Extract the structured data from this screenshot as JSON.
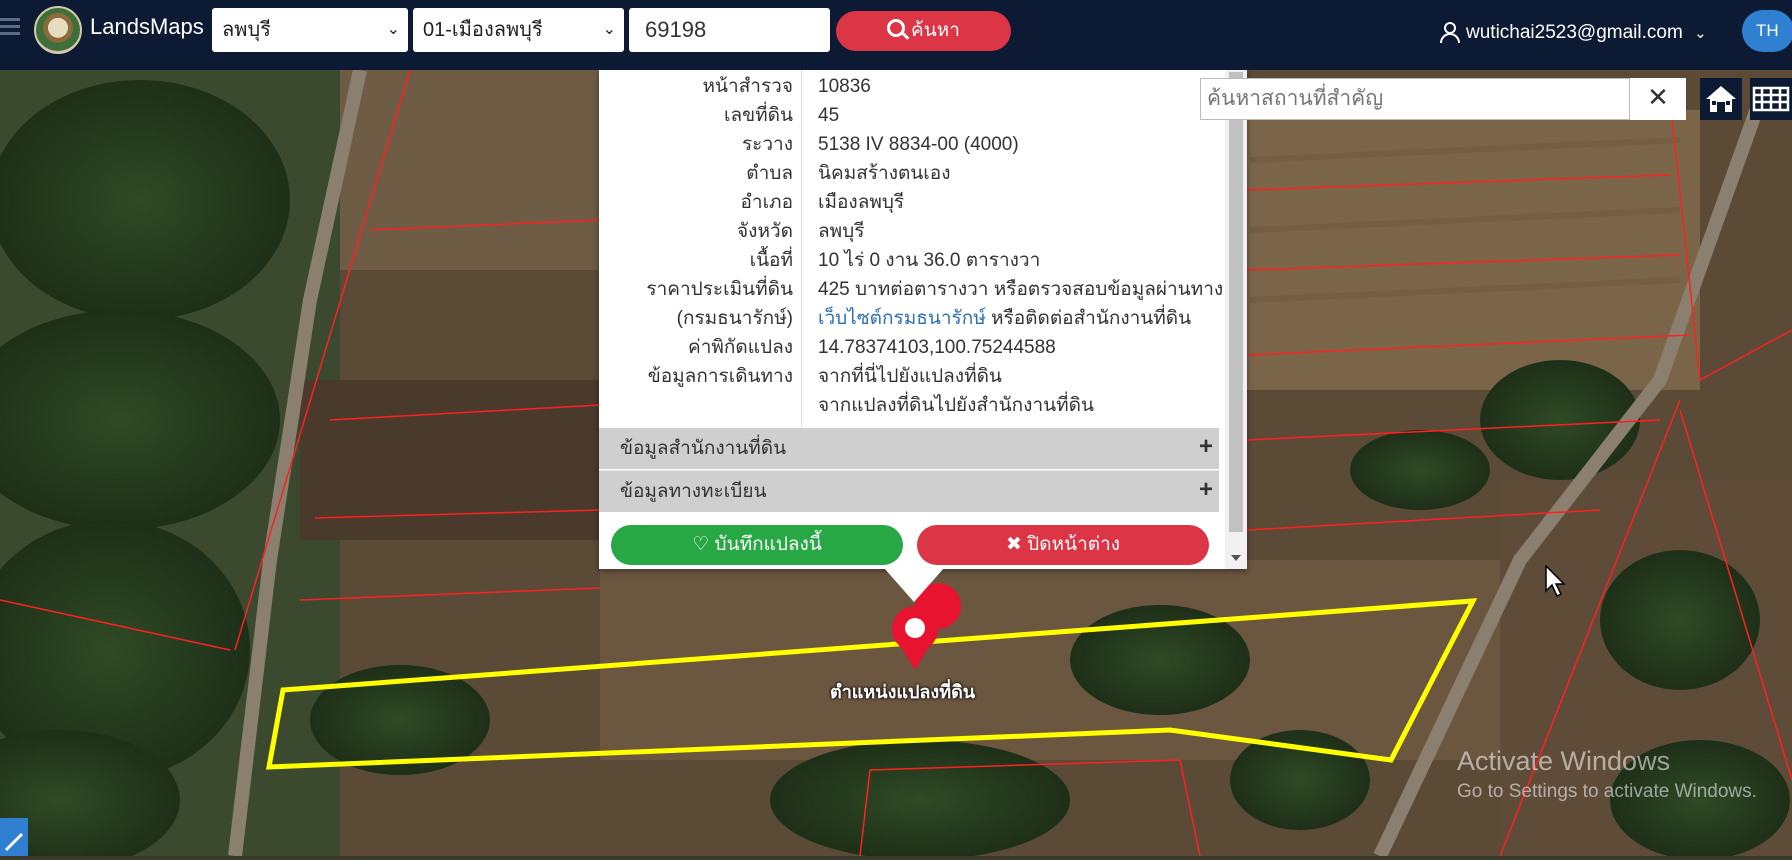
{
  "header": {
    "brand": "LandsMaps",
    "province_select": "ลพบุรี",
    "district_select": "01-เมืองลพบุรี",
    "parcel_number": "69198",
    "search_button": "ค้นหา",
    "user_email": "wutichai2523@gmail.com",
    "language": "TH"
  },
  "popup": {
    "rows": [
      {
        "key": "หน้าสำรวจ",
        "value": "10836"
      },
      {
        "key": "เลขที่ดิน",
        "value": "45"
      },
      {
        "key": "ระวาง",
        "value": "5138 IV 8834-00 (4000)"
      },
      {
        "key": "ตำบล",
        "value": "นิคมสร้างตนเอง"
      },
      {
        "key": "อำเภอ",
        "value": "เมืองลพบุรี"
      },
      {
        "key": "จังหวัด",
        "value": "ลพบุรี"
      },
      {
        "key": "เนื้อที่",
        "value": "10 ไร่ 0 งาน 36.0 ตารางวา"
      }
    ],
    "price_key_1": "ราคาประเมินที่ดิน",
    "price_key_2": "(กรมธนารักษ์)",
    "price_value_1": "425 บาทต่อตารางวา หรือตรวจสอบข้อมูลผ่านทาง",
    "price_link": "เว็บไซต์กรมธนารักษ์",
    "price_value_2": " หรือติดต่อสำนักงานที่ดิน",
    "coord_key": "ค่าพิกัดแปลง",
    "coord_value": "14.78374103,100.75244588",
    "travel_key": "ข้อมูลการเดินทาง",
    "travel_link_1": "จากที่นี่ไปยังแปลงที่ดิน",
    "travel_link_2": "จากแปลงที่ดินไปยังสำนักงานที่ดิน",
    "accordion_office": "ข้อมูลสำนักงานที่ดิน",
    "accordion_registry": "ข้อมูลทางทะเบียน",
    "save_button": "บันทึกแปลงนี้",
    "close_button": "ปิดหน้าต่าง"
  },
  "map": {
    "place_search_placeholder": "ค้นหาสถานที่สำคัญ",
    "marker_label": "ตำแหน่งแปลงที่ดิน",
    "parcel_outline_color": "#ffff00",
    "boundary_color": "#ff2020",
    "marker_color": "#e8132e"
  },
  "watermark": {
    "line1": "Activate Windows",
    "line2": "Go to Settings to activate Windows."
  },
  "icons": {
    "search": "magnifier-icon",
    "heart": "heart-icon",
    "close": "x-icon",
    "home": "home-icon",
    "grid": "grid-icon",
    "user": "user-icon"
  }
}
